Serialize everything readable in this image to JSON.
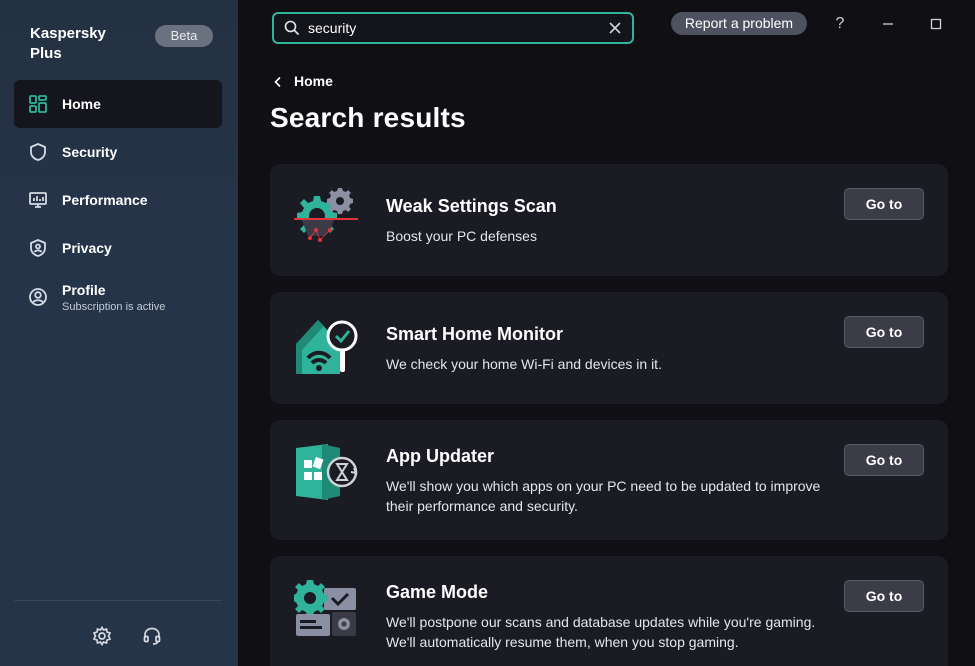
{
  "app": {
    "name": "Kaspersky Plus",
    "badge": "Beta"
  },
  "sidebar": {
    "items": [
      {
        "label": "Home",
        "icon": "grid-icon",
        "active": true
      },
      {
        "label": "Security",
        "icon": "shield-icon"
      },
      {
        "label": "Performance",
        "icon": "monitor-icon"
      },
      {
        "label": "Privacy",
        "icon": "privacy-shield-icon"
      },
      {
        "label": "Profile",
        "icon": "profile-icon",
        "sublabel": "Subscription is active"
      }
    ],
    "bottom_icons": [
      "gear-icon",
      "headset-icon"
    ]
  },
  "search": {
    "value": "security",
    "placeholder": ""
  },
  "topbar": {
    "report_label": "Report a problem",
    "help": "?",
    "minimize": "–",
    "maximize": "□"
  },
  "breadcrumb": {
    "label": "Home"
  },
  "page": {
    "title": "Search results"
  },
  "results": [
    {
      "title": "Weak Settings Scan",
      "description": "Boost your PC defenses",
      "button": "Go to",
      "icon": "gear-scan-icon"
    },
    {
      "title": "Smart Home Monitor",
      "description": "We check your home Wi-Fi and devices in it.",
      "button": "Go to",
      "icon": "smart-home-icon"
    },
    {
      "title": "App Updater",
      "description": "We'll show you which apps on your PC need to be updated to improve their performance and security.",
      "button": "Go to",
      "icon": "app-updater-icon"
    },
    {
      "title": "Game Mode",
      "description": "We'll postpone our scans and database updates while you're gaming. We'll automatically resume them, when you stop gaming.",
      "button": "Go to",
      "icon": "game-mode-icon"
    }
  ],
  "colors": {
    "accent": "#2fb39a",
    "card": "#1b1b24",
    "sidebar": "#243142"
  }
}
